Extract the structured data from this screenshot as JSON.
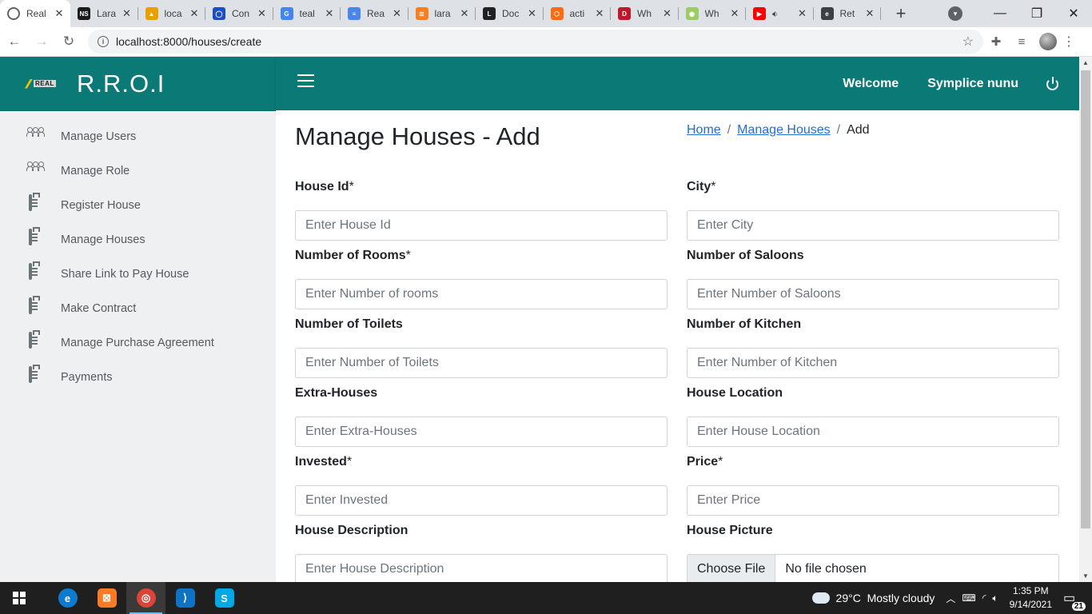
{
  "browser": {
    "tabs": [
      {
        "title": "Real",
        "icon": "globe-icon",
        "color": "#5f6368",
        "active": true
      },
      {
        "title": "Lara",
        "icon": "ns-icon",
        "color": "#1b1b1b",
        "glyph": "NS"
      },
      {
        "title": "loca",
        "icon": "phpmyadmin-icon",
        "color": "#e8a000",
        "glyph": "▲"
      },
      {
        "title": "Con",
        "icon": "circle-logo-icon",
        "color": "#1a4ec2",
        "glyph": "◯"
      },
      {
        "title": "teal",
        "icon": "google-icon",
        "color": "#4285f4",
        "glyph": "G"
      },
      {
        "title": "Rea",
        "icon": "docs-icon",
        "color": "#4a86e8",
        "glyph": "≡"
      },
      {
        "title": "lara",
        "icon": "stackoverflow-icon",
        "color": "#f48024",
        "glyph": "≣"
      },
      {
        "title": "Doc",
        "icon": "laravel-icon",
        "color": "#202124",
        "glyph": "L"
      },
      {
        "title": "acti",
        "icon": "hexagon-icon",
        "color": "#ff6a13",
        "glyph": "⬡"
      },
      {
        "title": "Wh",
        "icon": "d-icon",
        "color": "#c4162a",
        "glyph": "D"
      },
      {
        "title": "Wh",
        "icon": "whatsapp-icon",
        "color": "#9ccc65",
        "glyph": "◉"
      },
      {
        "title": "",
        "icon": "youtube-icon",
        "color": "#ff0000",
        "glyph": "▶"
      },
      {
        "title": "Ret",
        "icon": "edge-logo-icon",
        "color": "#3c4043",
        "glyph": "e"
      }
    ],
    "url": "localhost:8000/houses/create"
  },
  "app": {
    "brand_logo_text": "REAL",
    "brand_title": "R.R.O.I",
    "welcome": "Welcome",
    "user_name": "Symplice nunu"
  },
  "sidebar": {
    "items": [
      {
        "label": "Manage Users",
        "icon": "users-icon"
      },
      {
        "label": "Manage Role",
        "icon": "users-icon"
      },
      {
        "label": "Register House",
        "icon": "clipboard-icon"
      },
      {
        "label": "Manage Houses",
        "icon": "clipboard-icon"
      },
      {
        "label": "Share Link to Pay House",
        "icon": "clipboard-icon"
      },
      {
        "label": "Make Contract",
        "icon": "clipboard-icon"
      },
      {
        "label": "Manage Purchase Agreement",
        "icon": "clipboard-icon"
      },
      {
        "label": "Payments",
        "icon": "clipboard-icon"
      }
    ]
  },
  "page": {
    "title": "Manage Houses - Add",
    "breadcrumb": {
      "home": "Home",
      "section": "Manage Houses",
      "current": "Add",
      "sep": "/"
    }
  },
  "form": {
    "house_id": {
      "label": "House Id",
      "required": "*",
      "placeholder": "Enter House Id"
    },
    "city": {
      "label": "City",
      "required": "*",
      "placeholder": "Enter City"
    },
    "rooms": {
      "label": "Number of Rooms",
      "required": "*",
      "placeholder": "Enter Number of rooms"
    },
    "saloons": {
      "label": "Number of Saloons",
      "placeholder": "Enter Number of Saloons"
    },
    "toilets": {
      "label": "Number of Toilets",
      "placeholder": "Enter Number of Toilets"
    },
    "kitchen": {
      "label": "Number of Kitchen",
      "placeholder": "Enter Number of Kitchen"
    },
    "extra": {
      "label": "Extra-Houses",
      "placeholder": "Enter Extra-Houses"
    },
    "location": {
      "label": "House Location",
      "placeholder": "Enter House Location"
    },
    "invested": {
      "label": "Invested",
      "required": "*",
      "placeholder": "Enter Invested"
    },
    "price": {
      "label": "Price",
      "required": "*",
      "placeholder": "Enter Price"
    },
    "description": {
      "label": "House Description",
      "placeholder": "Enter House Description"
    },
    "picture": {
      "label": "House Picture",
      "button": "Choose File",
      "status": "No file chosen"
    }
  },
  "taskbar": {
    "apps": [
      {
        "name": "edge-app-icon",
        "color": "#0f7bd0",
        "glyph": "e"
      },
      {
        "name": "xampp-app-icon",
        "color": "#fb7a24",
        "glyph": "⊠"
      },
      {
        "name": "chrome-app-icon",
        "color": "#db4437",
        "glyph": "◎",
        "active": true
      },
      {
        "name": "vscode-app-icon",
        "color": "#0e73c4",
        "glyph": "⟩"
      },
      {
        "name": "skype-app-icon",
        "color": "#00a8e6",
        "glyph": "S"
      }
    ],
    "weather": "29°C  Mostly cloudy",
    "time": "1:35 PM",
    "date": "9/14/2021",
    "notifications": "21"
  }
}
